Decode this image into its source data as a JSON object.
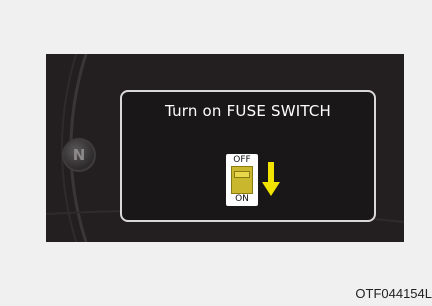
{
  "display": {
    "message": "Turn on FUSE SWITCH",
    "fuse_switch": {
      "top_label": "OFF",
      "bottom_label": "ON"
    },
    "gear_indicator": "N"
  },
  "figure_code": "OTF044154L",
  "colors": {
    "background": "#231f20",
    "message_border": "#d9d9d9",
    "text": "#ffffff",
    "arrow": "#f2e300",
    "switch_body": "#c9b72e"
  }
}
